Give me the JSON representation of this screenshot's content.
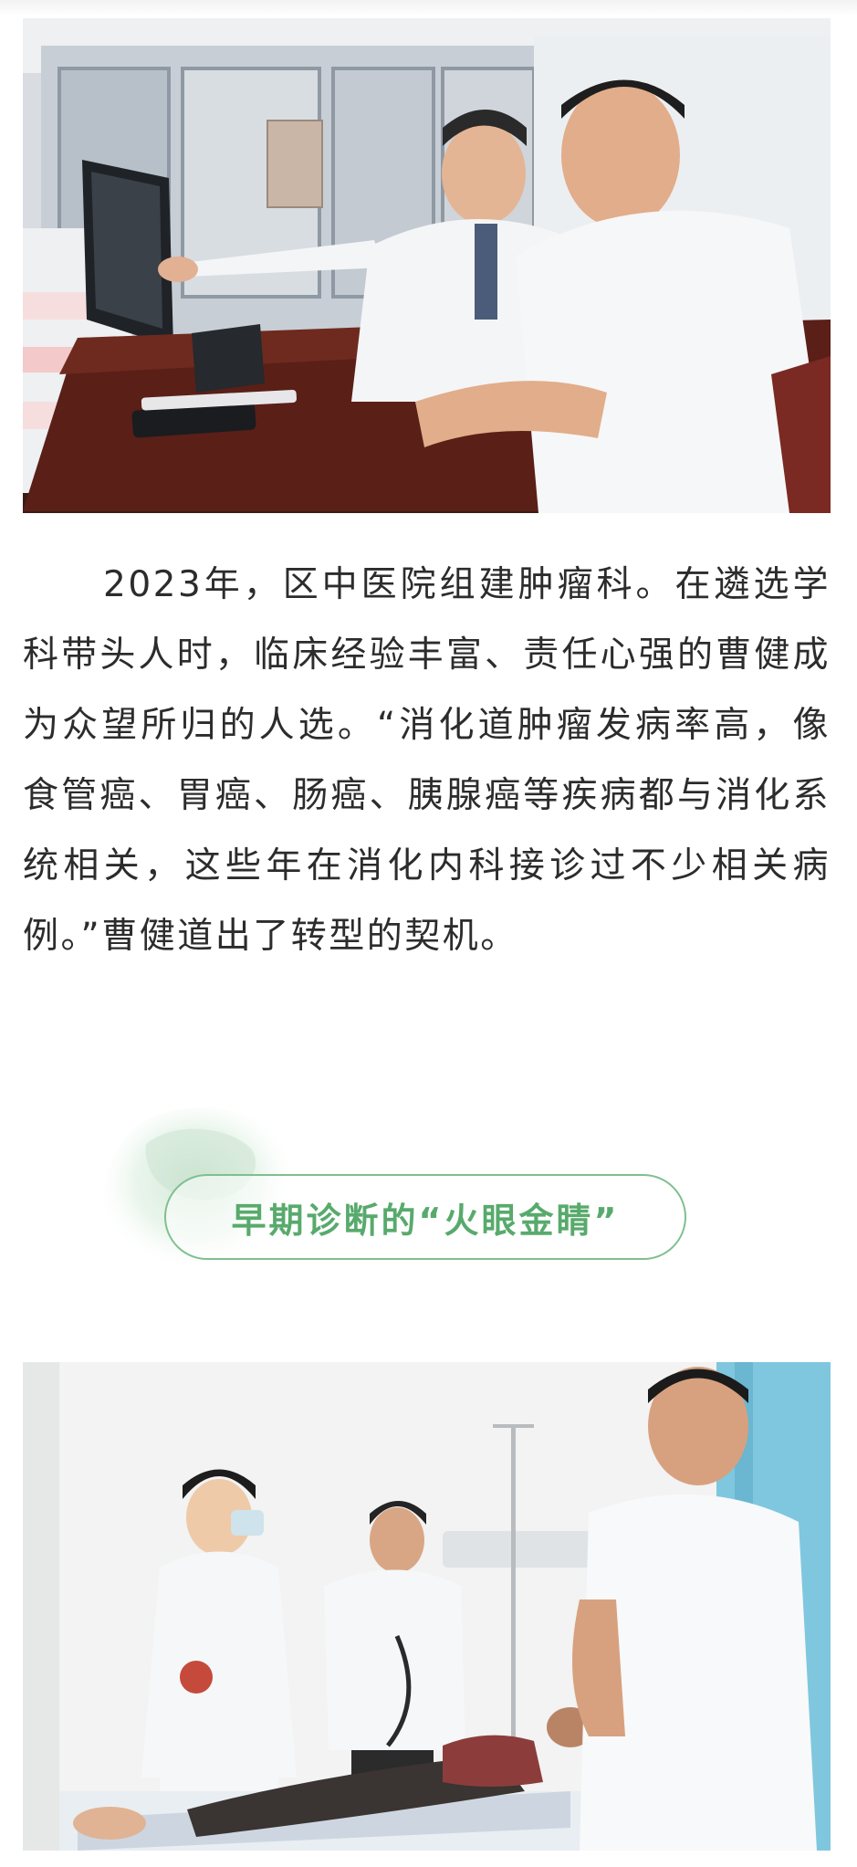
{
  "article": {
    "paragraph": "2023年，区中医院组建肿瘤科。在遴选学科带头人时，临床经验丰富、责任心强的曹健成为众望所归的人选。“消化道肿瘤发病率高，像食管癌、胃癌、肠癌、胰腺癌等疾病都与消化系统相关，这些年在消化内科接诊过不少相关病例。”曹健道出了转型的契机。"
  },
  "section": {
    "heading": "早期诊断的“火眼金睛”"
  },
  "colors": {
    "heading_green": "#58aa6c",
    "pill_border": "#7fbf8f",
    "text": "#2c2c2c"
  }
}
